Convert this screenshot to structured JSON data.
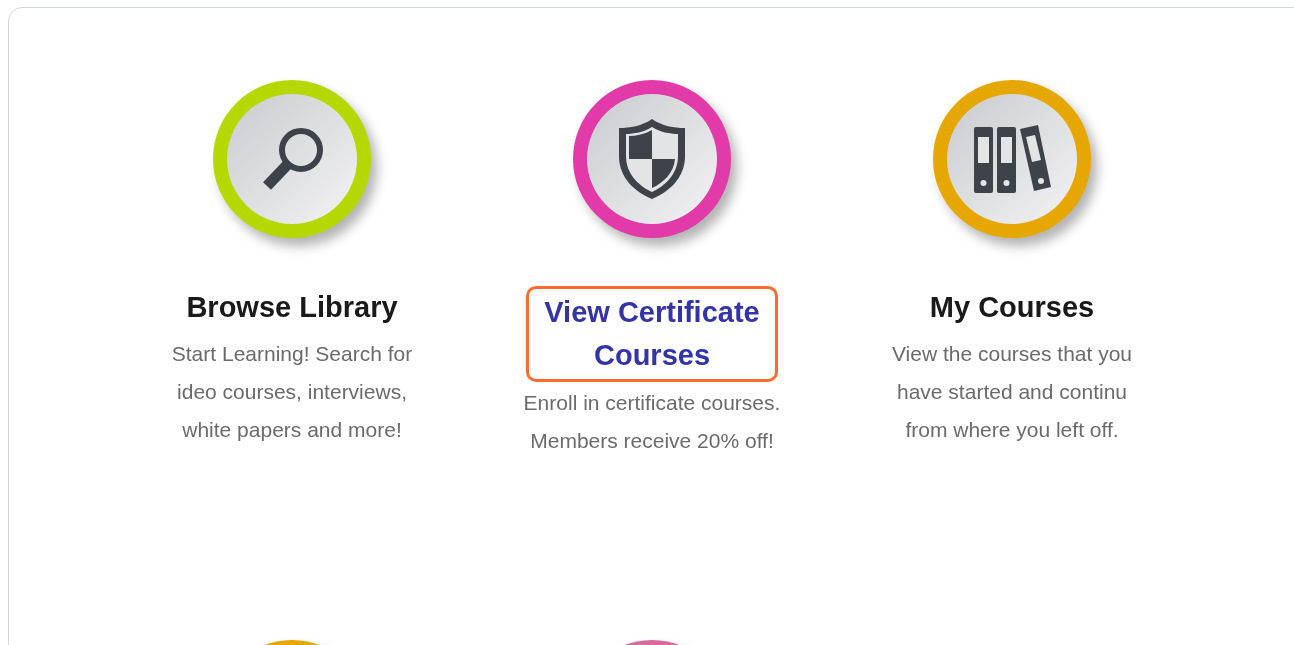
{
  "tiles": [
    {
      "kind": "search",
      "color": "#b5d900",
      "title": "Browse Library",
      "link": false,
      "highlighted": false,
      "description": [
        "Start Learning! Search for",
        "ideo courses, interviews,",
        "white papers and more!"
      ]
    },
    {
      "kind": "shield",
      "color": "#e23aa8",
      "title": "View Certificate Courses",
      "link": true,
      "highlighted": true,
      "description": [
        "Enroll in certificate courses.",
        "Members receive 20% off!"
      ]
    },
    {
      "kind": "binders",
      "color": "#e6a800",
      "title": "My Courses",
      "link": false,
      "highlighted": false,
      "description": [
        "View the courses that you",
        "have started and continu",
        "from where you left off."
      ]
    }
  ],
  "partial_tiles": [
    {
      "color": "#e6a800"
    },
    {
      "color": "#d66a9a"
    }
  ]
}
